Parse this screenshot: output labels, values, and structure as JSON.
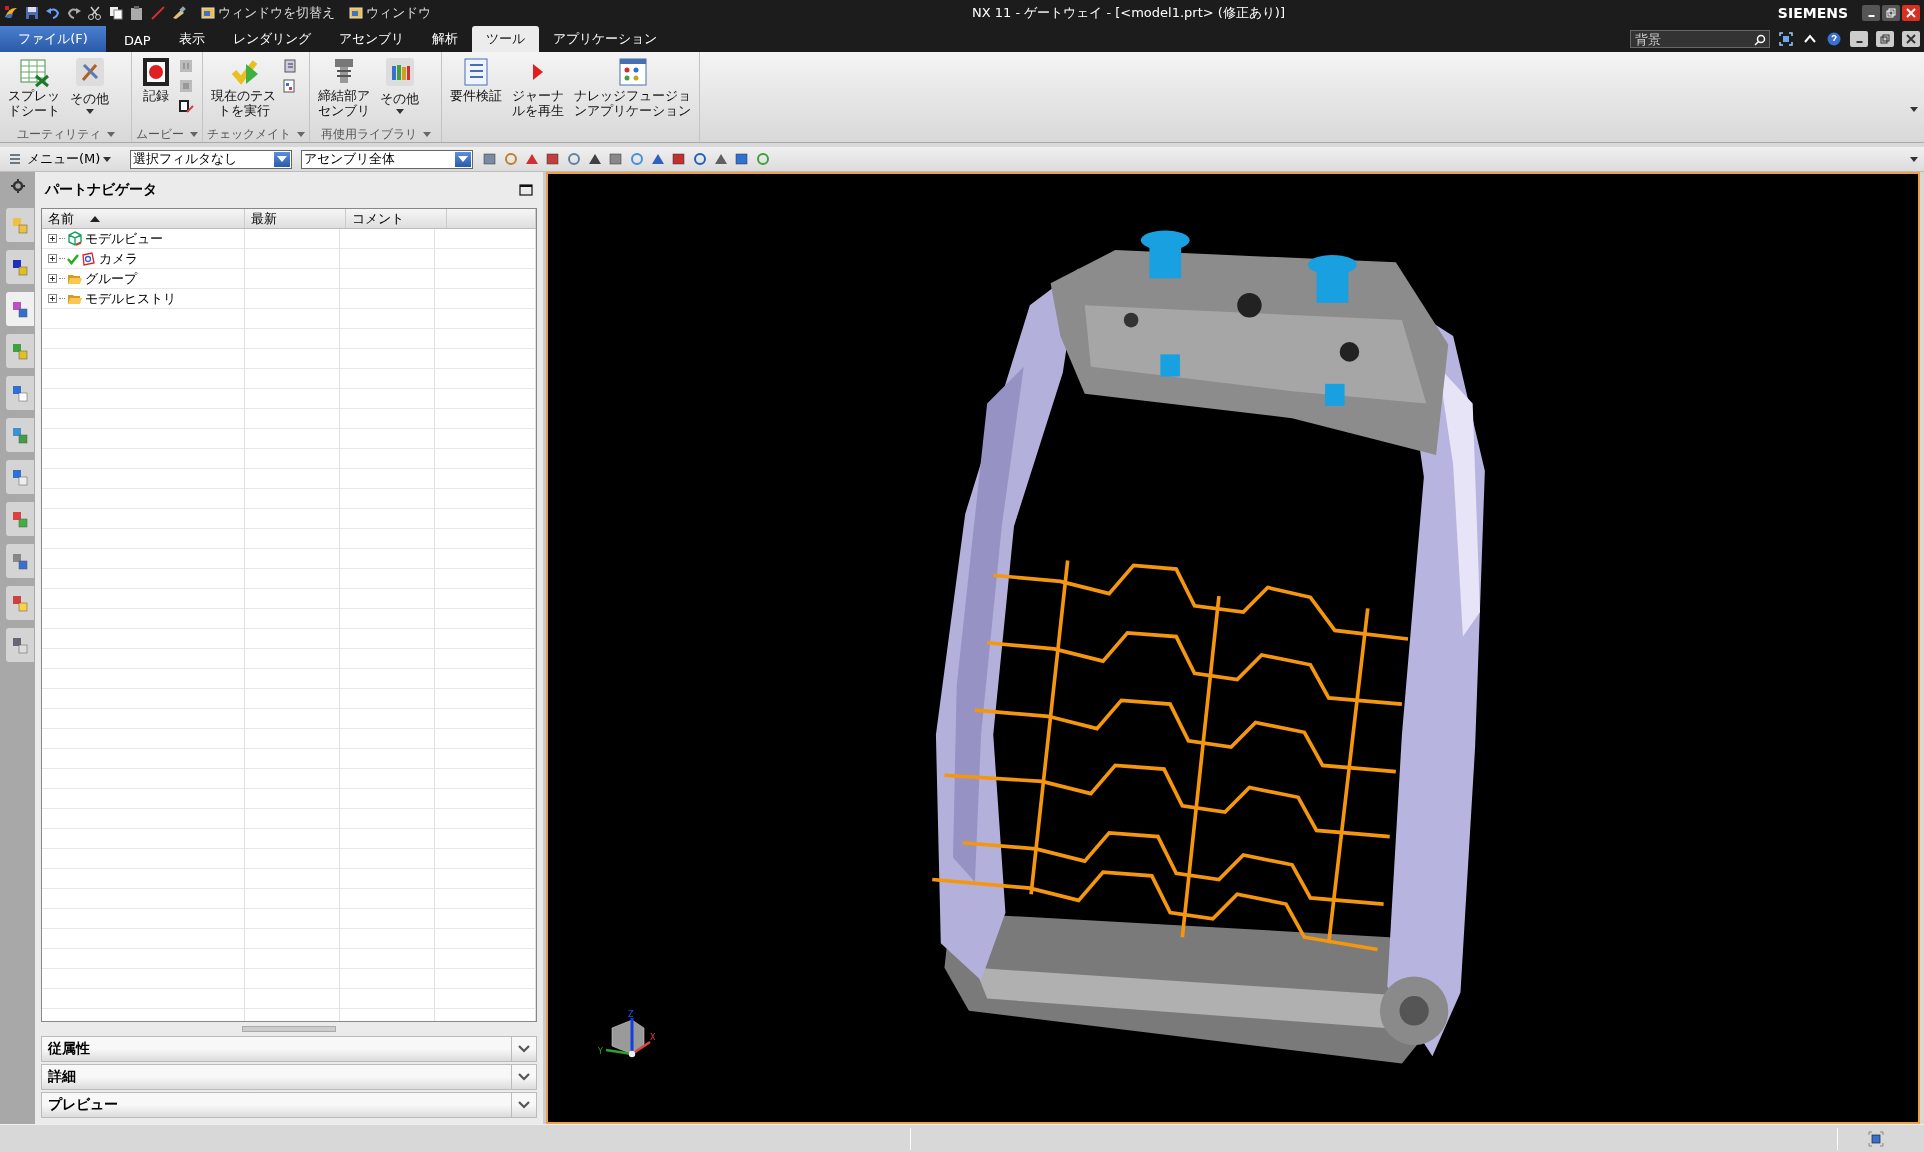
{
  "title_bar": {
    "commands": [
      {
        "label": "ウィンドウを切替え"
      },
      {
        "label": "ウィンドウ"
      }
    ],
    "title": "NX 11 - ゲートウェイ - [<model1.prt> (修正あり)]",
    "brand": "SIEMENS"
  },
  "tabs": [
    {
      "label": "ファイル(F)",
      "kind": "file",
      "selected": false
    },
    {
      "label": "DAP",
      "kind": "tab",
      "selected": false
    },
    {
      "label": "表示",
      "kind": "tab",
      "selected": false
    },
    {
      "label": "レンダリング",
      "kind": "tab",
      "selected": false
    },
    {
      "label": "アセンブリ",
      "kind": "tab",
      "selected": false
    },
    {
      "label": "解析",
      "kind": "tab",
      "selected": false
    },
    {
      "label": "ツール",
      "kind": "tab",
      "selected": true
    },
    {
      "label": "アプリケーション",
      "kind": "tab",
      "selected": false
    }
  ],
  "search": {
    "placeholder": "背景"
  },
  "ribbon_groups": [
    {
      "label": "ユーティリティ",
      "items": [
        {
          "kind": "large",
          "label": "スプレッドシート"
        },
        {
          "kind": "menu",
          "label": "その他"
        }
      ]
    },
    {
      "label": "ムービー",
      "items": [
        {
          "kind": "large",
          "label": "記録"
        },
        {
          "kind": "small"
        }
      ]
    },
    {
      "label": "チェックメイト",
      "items": [
        {
          "kind": "large",
          "label": "現在のテストを実行"
        },
        {
          "kind": "small"
        }
      ]
    },
    {
      "label": "再使用ライブラリ",
      "items": [
        {
          "kind": "large",
          "label": "締結部アセンブリ"
        },
        {
          "kind": "menu",
          "label": "その他"
        }
      ]
    },
    {
      "items": [
        {
          "kind": "large",
          "label": "要件検証"
        },
        {
          "kind": "large",
          "label": "ジャーナルを再生"
        },
        {
          "kind": "large",
          "label": "ナレッジフュージョンアプリケーション"
        }
      ]
    }
  ],
  "resource_tabs": [
    {
      "selected": false
    },
    {
      "selected": false
    },
    {
      "selected": true
    },
    {
      "selected": false
    },
    {
      "selected": false
    },
    {
      "selected": false
    },
    {
      "selected": false
    },
    {
      "selected": false
    },
    {
      "selected": false
    },
    {
      "selected": false
    },
    {
      "selected": false
    }
  ],
  "toolbar": {
    "menu": "メニュー(M)",
    "dropdowns": [
      {
        "value": "選択フィルタなし"
      },
      {
        "value": "アセンブリ全体"
      }
    ]
  },
  "navigator": {
    "title": "パートナビゲータ",
    "columns": [
      {
        "label": "名前",
        "sorted": true
      },
      {
        "label": "最新",
        "sorted": false
      },
      {
        "label": "コメント",
        "sorted": false
      }
    ],
    "rows": [
      {
        "label": "モデルビュー",
        "kind": "view",
        "checked": false
      },
      {
        "label": "カメラ",
        "kind": "camera",
        "checked": true
      },
      {
        "label": "グループ",
        "kind": "folder",
        "checked": false
      },
      {
        "label": "モデルヒストリ",
        "kind": "folder",
        "checked": false
      }
    ]
  },
  "panels": [
    {
      "label": "従属性",
      "expanded": false
    },
    {
      "label": "詳細",
      "expanded": false
    },
    {
      "label": "プレビュー",
      "expanded": false
    }
  ],
  "triad": {
    "x": "X",
    "y": "Y",
    "z": "Z"
  }
}
